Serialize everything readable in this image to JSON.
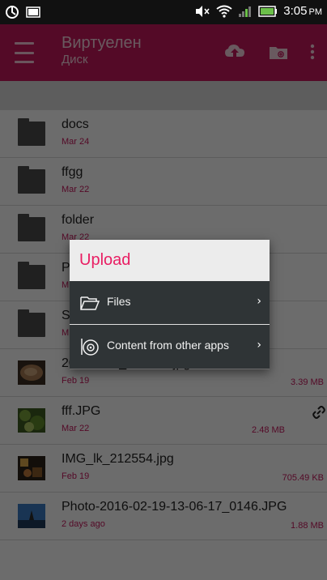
{
  "status_bar": {
    "time": "3:05",
    "ampm": "PM"
  },
  "app_bar": {
    "title": "Виртуелен",
    "subtitle": "Диск"
  },
  "files": [
    {
      "name": "docs",
      "date": "Mar 24",
      "size": "",
      "type": "folder"
    },
    {
      "name": "ffgg",
      "date": "Mar 22",
      "size": "",
      "type": "folder"
    },
    {
      "name": "folder",
      "date": "Mar 22",
      "size": "",
      "type": "folder"
    },
    {
      "name": "P",
      "date": "M",
      "size": "",
      "type": "folder"
    },
    {
      "name": "S",
      "date": "M",
      "size": "",
      "type": "folder"
    },
    {
      "name": "20151018_223736.jpg",
      "date": "Feb 19",
      "size": "3.39 MB",
      "type": "image"
    },
    {
      "name": "fff.JPG",
      "date": "Mar 22",
      "size": "2.48 MB",
      "type": "image"
    },
    {
      "name": "IMG_lk_212554.jpg",
      "date": "Feb 19",
      "size": "705.49 KB",
      "type": "image"
    },
    {
      "name": "Photo-2016-02-19-13-06-17_0146.JPG",
      "date": "2 days ago",
      "size": "1.88 MB",
      "type": "image"
    }
  ],
  "dialog": {
    "title": "Upload",
    "items": [
      {
        "label": "Files",
        "icon": "folder-open-icon"
      },
      {
        "label": "Content from other apps",
        "icon": "disc-icon"
      }
    ]
  },
  "colors": {
    "accent": "#c2185b",
    "dialog_title": "#e91e63",
    "dialog_bg": "#2f3436"
  }
}
